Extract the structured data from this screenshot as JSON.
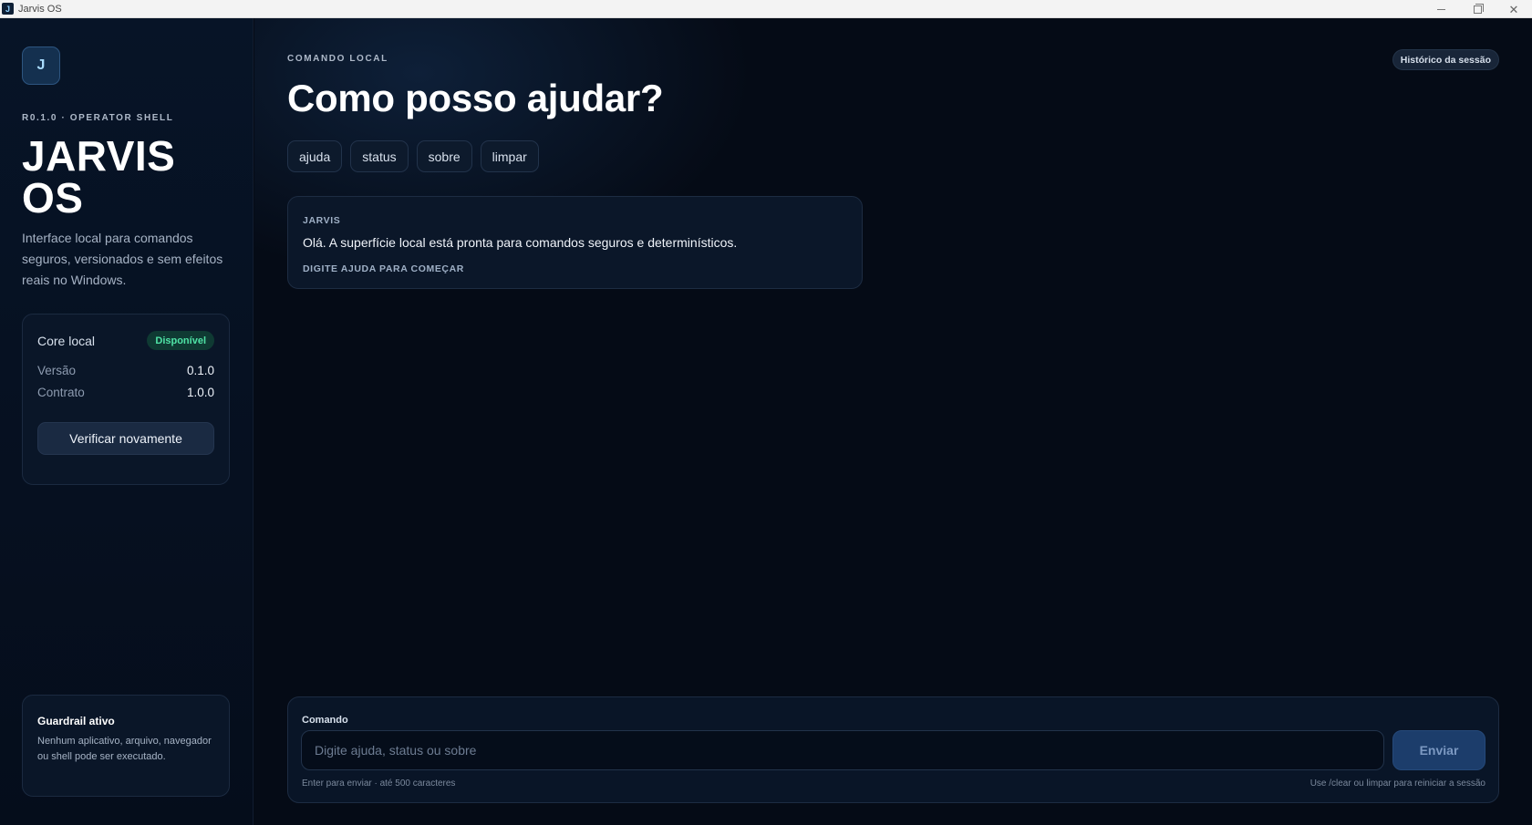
{
  "window": {
    "title": "Jarvis OS",
    "app_icon_letter": "J"
  },
  "sidebar": {
    "logo_letter": "J",
    "version_tag": "R0.1.0 · OPERATOR SHELL",
    "brand_title": "JARVIS OS",
    "description": "Interface local para comandos seguros, versionados e sem efeitos reais no Windows.",
    "core_card": {
      "label": "Core local",
      "status_badge": "Disponível",
      "rows": [
        {
          "key": "Versão",
          "value": "0.1.0"
        },
        {
          "key": "Contrato",
          "value": "1.0.0"
        }
      ],
      "verify_button": "Verificar novamente"
    },
    "guardrail_card": {
      "title": "Guardrail ativo",
      "body": "Nenhum aplicativo, arquivo, navegador ou shell pode ser executado."
    }
  },
  "main": {
    "eyebrow": "COMANDO LOCAL",
    "hero_title": "Como posso ajudar?",
    "history_button": "Histórico da sessão",
    "chips": [
      "ajuda",
      "status",
      "sobre",
      "limpar"
    ],
    "message": {
      "sender": "JARVIS",
      "text": "Olá. A superfície local está pronta para comandos seguros e determinísticos.",
      "hint": "DIGITE AJUDA PARA COMEÇAR"
    },
    "command": {
      "label": "Comando",
      "value": "",
      "placeholder": "Digite ajuda, status ou sobre",
      "send_button": "Enviar",
      "footer_left": "Enter para enviar · até 500 caracteres",
      "footer_right": "Use /clear ou limpar para reiniciar a sessão"
    }
  },
  "colors": {
    "background": "#050b16",
    "sidebar": "#071427",
    "accent": "#1c3d6b",
    "status_green": "#4fe3a6"
  }
}
